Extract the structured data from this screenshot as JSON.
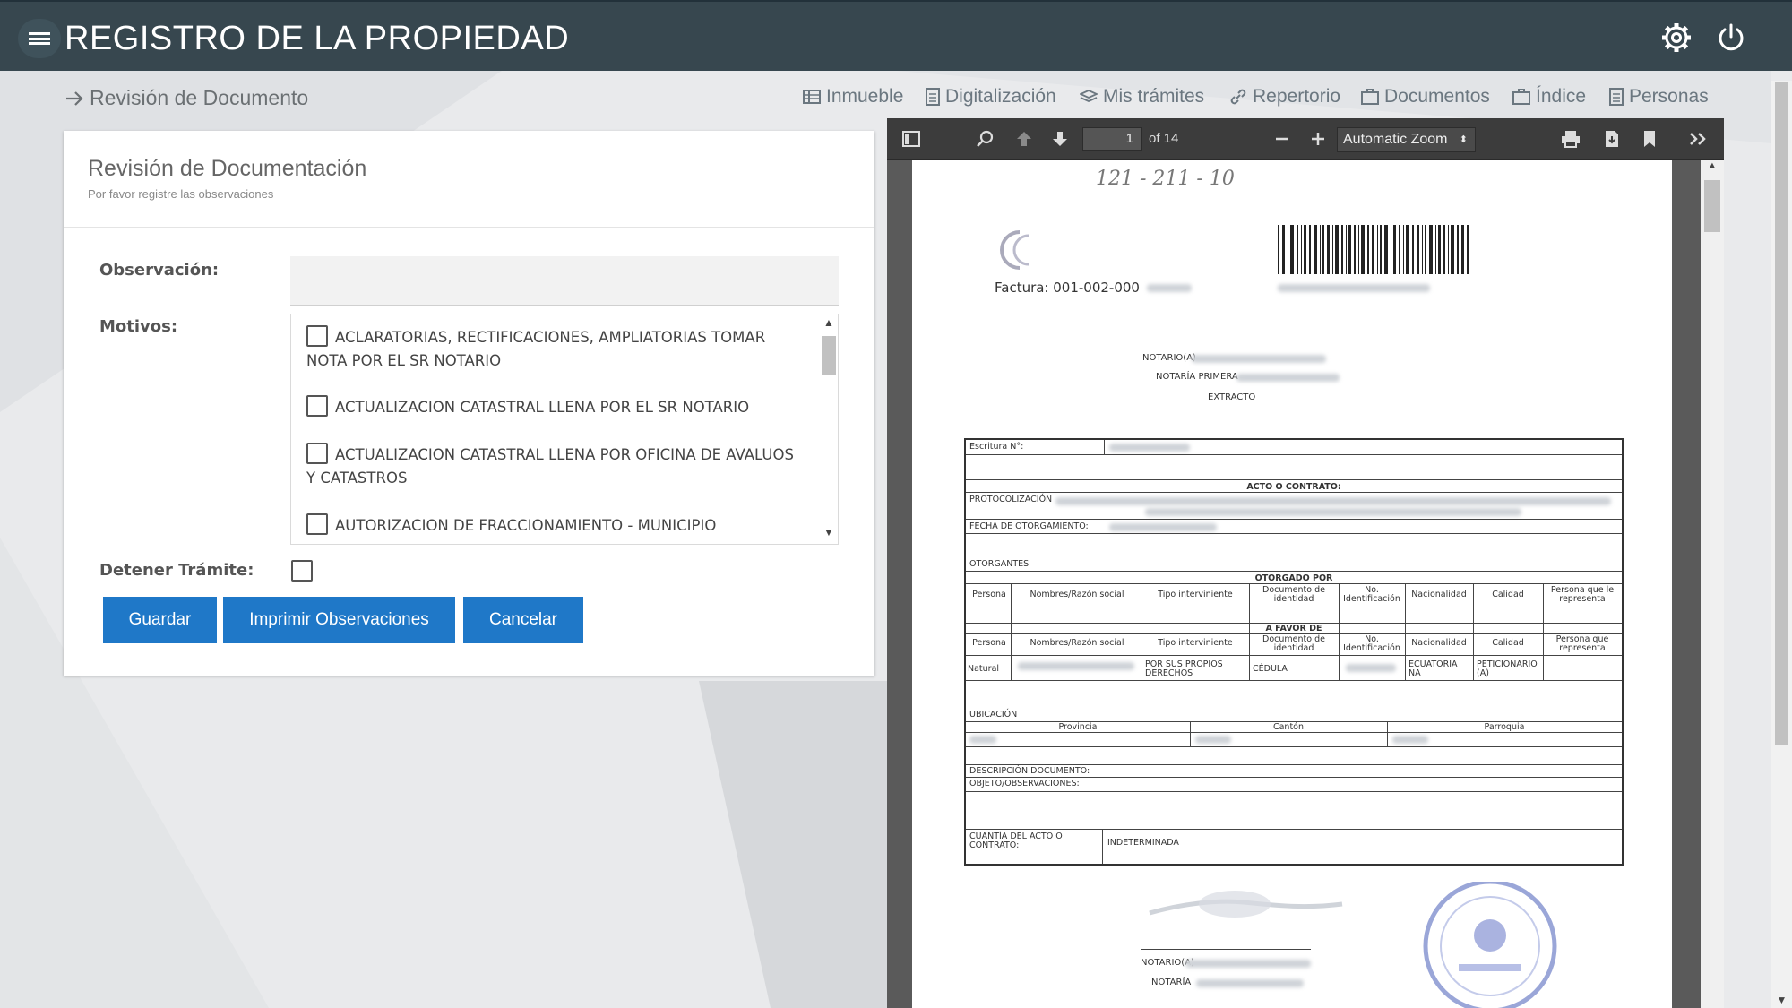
{
  "app": {
    "title": "REGISTRO DE LA PROPIEDAD"
  },
  "header_icons": {
    "settings": "gear-icon",
    "logout": "power-icon",
    "menu": "hamburger-icon"
  },
  "breadcrumb": {
    "label": "Revisión de Documento"
  },
  "nav": {
    "items": [
      {
        "label": "Inmueble",
        "icon": "building-icon"
      },
      {
        "label": "Digitalización",
        "icon": "document-icon"
      },
      {
        "label": "Mis trámites",
        "icon": "layers-icon"
      },
      {
        "label": "Repertorio",
        "icon": "link-icon"
      },
      {
        "label": "Documentos",
        "icon": "briefcase-icon"
      },
      {
        "label": "Índice",
        "icon": "briefcase-icon"
      },
      {
        "label": "Personas",
        "icon": "document-icon"
      }
    ]
  },
  "form": {
    "title": "Revisión de Documentación",
    "subtitle": "Por favor registre las observaciones",
    "observacion_label": "Observación:",
    "observacion_value": "",
    "motivos_label": "Motivos:",
    "motivos": [
      {
        "label": "ACLARATORIAS, RECTIFICACIONES, AMPLIATORIAS TOMAR NOTA POR EL SR NOTARIO",
        "checked": false
      },
      {
        "label": "ACTUALIZACION CATASTRAL LLENA POR EL SR NOTARIO",
        "checked": false
      },
      {
        "label": "ACTUALIZACION CATASTRAL LLENA POR OFICINA DE AVALUOS Y CATASTROS",
        "checked": false
      },
      {
        "label": "AUTORIZACION DE FRACCIONAMIENTO - MUNICIPIO",
        "checked": false
      }
    ],
    "detener_label": "Detener Trámite:",
    "detener_checked": false,
    "buttons": {
      "save": "Guardar",
      "print": "Imprimir Observaciones",
      "cancel": "Cancelar"
    }
  },
  "viewer": {
    "page_number": "1",
    "page_count_text": "of 14",
    "zoom": "Automatic Zoom",
    "accent": "#3c3c3c"
  },
  "document": {
    "handwritten": "121 - 211 - 10",
    "factura": "Factura: 001-002-000",
    "notario_label": "NOTARIO(A)",
    "notaria_label": "NOTARÍA PRIMERA",
    "extracto": "EXTRACTO",
    "escritura_label": "Escritura N°:",
    "acto_label": "ACTO O CONTRATO:",
    "protocolizacion": "PROTOCOLIZACIÓN",
    "fecha_label": "FECHA DE OTORGAMIENTO:",
    "otorgantes_label": "OTORGANTES",
    "otorgado_por": "OTORGADO POR",
    "a_favor_de": "A FAVOR DE",
    "col_headers": [
      "Persona",
      "Nombres/Razón social",
      "Tipo interviniente",
      "Documento de identidad",
      "No. Identificación",
      "Nacionalidad",
      "Calidad",
      "Persona que le representa"
    ],
    "col_headers_2": [
      "Persona",
      "Nombres/Razón social",
      "Tipo interviniente",
      "Documento de identidad",
      "No. Identificación",
      "Nacionalidad",
      "Calidad",
      "Persona que representa"
    ],
    "row_values": [
      "Natural",
      "",
      "POR SUS PROPIOS DERECHOS",
      "CÉDULA",
      "",
      "ECUATORIA NA",
      "PETICIONARIO (A)",
      ""
    ],
    "ubicacion_label": "UBICACIÓN",
    "ubicacion_cols": [
      "Provincia",
      "Cantón",
      "Parroquia"
    ],
    "descripcion_label": "DESCRIPCIÓN DOCUMENTO:",
    "objeto_label": "OBJETO/OBSERVACIONES:",
    "cuantia_label": "CUANTÍA DEL ACTO O CONTRATO:",
    "cuantia_value": "INDETERMINADA",
    "footer_notario": "NOTARIO(A)",
    "footer_notaria": "NOTARÍA"
  }
}
